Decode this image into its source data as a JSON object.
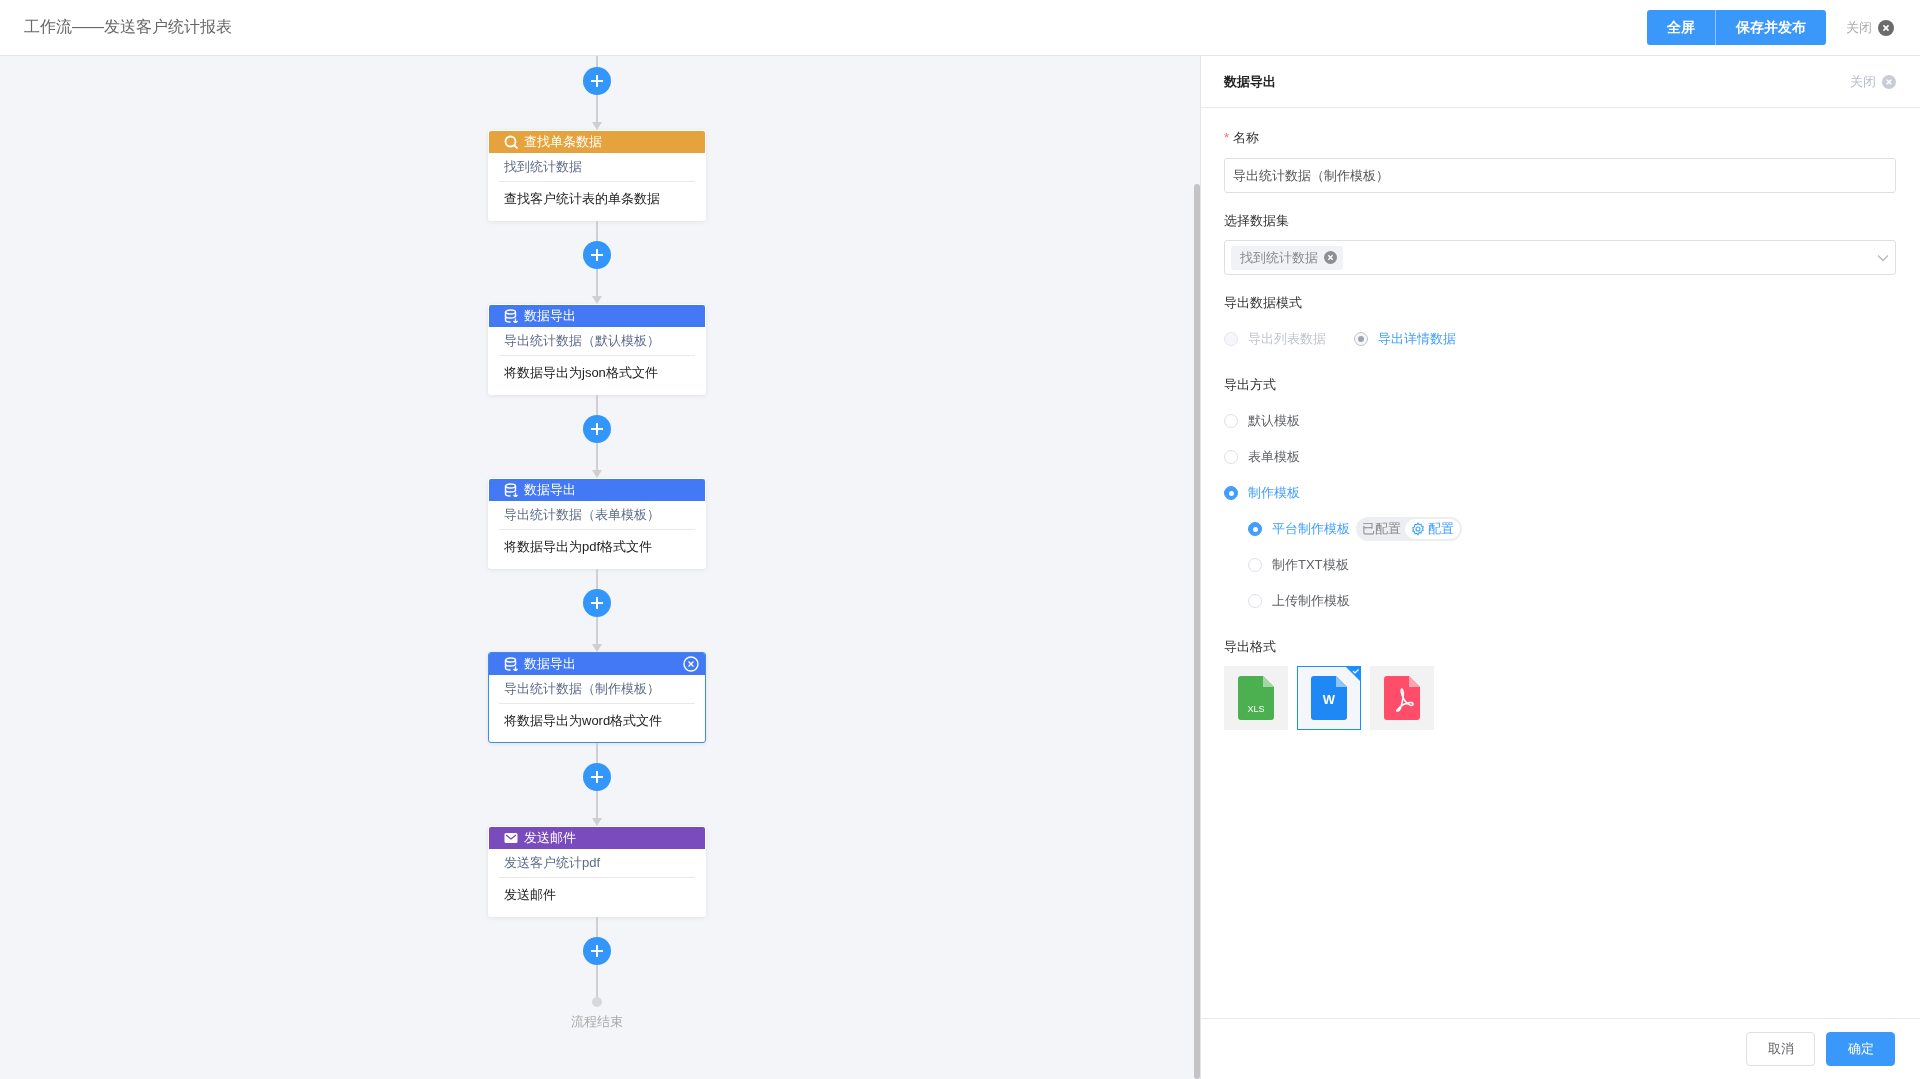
{
  "header": {
    "title": "工作流——发送客户统计报表",
    "buttons": [
      {
        "label": "全屏"
      },
      {
        "label": "保存并发布"
      }
    ],
    "close_label": "关闭"
  },
  "flow": {
    "nodes": [
      {
        "kind": "query",
        "title": "查找单条数据",
        "name": "找到统计数据",
        "description": "查找客户统计表的单条数据",
        "selected": false
      },
      {
        "kind": "export",
        "title": "数据导出",
        "name": "导出统计数据（默认模板）",
        "description": "将数据导出为json格式文件",
        "selected": false
      },
      {
        "kind": "export",
        "title": "数据导出",
        "name": "导出统计数据（表单模板）",
        "description": "将数据导出为pdf格式文件",
        "selected": false
      },
      {
        "kind": "export",
        "title": "数据导出",
        "name": "导出统计数据（制作模板）",
        "description": "将数据导出为word格式文件",
        "selected": true
      },
      {
        "kind": "email",
        "title": "发送邮件",
        "name": "发送客户统计pdf",
        "description": "发送邮件",
        "selected": false
      }
    ],
    "end_label": "流程结束"
  },
  "panel": {
    "title": "数据导出",
    "close_label": "关闭",
    "name_field": {
      "required_mark": "*",
      "label": "名称",
      "value": "导出统计数据（制作模板）"
    },
    "dataset_field": {
      "label": "选择数据集",
      "tags": [
        "找到统计数据"
      ]
    },
    "export_mode": {
      "label": "导出数据模式",
      "options": [
        {
          "label": "导出列表数据",
          "selected": false,
          "disabled": true
        },
        {
          "label": "导出详情数据",
          "selected": true,
          "disabled": true
        }
      ]
    },
    "export_method": {
      "label": "导出方式",
      "options": [
        {
          "label": "默认模板",
          "selected": false
        },
        {
          "label": "表单模板",
          "selected": false
        },
        {
          "label": "制作模板",
          "selected": true,
          "children": [
            {
              "label": "平台制作模板",
              "selected": true,
              "status": "已配置",
              "action": "配置"
            },
            {
              "label": "制作TXT模板",
              "selected": false
            },
            {
              "label": "上传制作模板",
              "selected": false
            }
          ]
        }
      ]
    },
    "export_format": {
      "label": "导出格式",
      "options": [
        {
          "kind": "xls",
          "text": "XLS",
          "selected": false
        },
        {
          "kind": "word",
          "text": "W",
          "selected": true
        },
        {
          "kind": "pdf",
          "selected": false
        }
      ]
    },
    "footer_buttons": [
      {
        "kind": "secondary",
        "label": "取消"
      },
      {
        "kind": "primary",
        "label": "确定"
      }
    ]
  }
}
